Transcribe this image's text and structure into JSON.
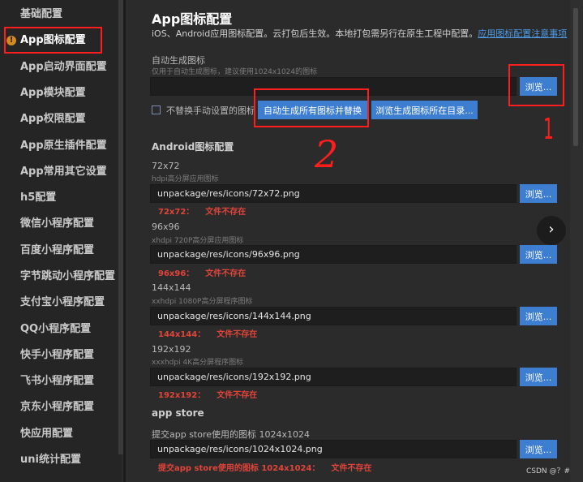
{
  "sidebar": {
    "items": [
      {
        "label": "基础配置"
      },
      {
        "label": "App图标配置"
      },
      {
        "label": "App启动界面配置"
      },
      {
        "label": "App模块配置"
      },
      {
        "label": "App权限配置"
      },
      {
        "label": "App原生插件配置"
      },
      {
        "label": "App常用其它设置"
      },
      {
        "label": "h5配置"
      },
      {
        "label": "微信小程序配置"
      },
      {
        "label": "百度小程序配置"
      },
      {
        "label": "字节跳动小程序配置"
      },
      {
        "label": "支付宝小程序配置"
      },
      {
        "label": "QQ小程序配置"
      },
      {
        "label": "快手小程序配置"
      },
      {
        "label": "飞书小程序配置"
      },
      {
        "label": "京东小程序配置"
      },
      {
        "label": "快应用配置"
      },
      {
        "label": "uni统计配置"
      }
    ],
    "warning_icon": "!"
  },
  "main": {
    "title": "App图标配置",
    "subtitle": "iOS、Android应用图标配置。云打包后生效。本地打包需另行在原生工程中配置。",
    "subtitle_link": "应用图标配置注意事项",
    "auto": {
      "label": "自动生成图标",
      "hint": "仅用于自动生成图标，建议使用1024x1024的图标",
      "value": "",
      "browse": "浏览...",
      "checkbox_label": "不替换手动设置的图标",
      "generate_button": "自动生成所有图标并替换",
      "browse_dir_button": "浏览生成图标所在目录..."
    },
    "android_section": "Android图标配置",
    "icons": [
      {
        "size": "72x72",
        "hint": "hdpi高分屏应用图标",
        "path": "unpackage/res/icons/72x72.png",
        "browse": "浏览...",
        "error_key": "72x72：",
        "error_msg": "文件不存在"
      },
      {
        "size": "96x96",
        "hint": "xhdpi 720P高分屏应用图标",
        "path": "unpackage/res/icons/96x96.png",
        "browse": "浏览...",
        "error_key": "96x96：",
        "error_msg": "文件不存在"
      },
      {
        "size": "144x144",
        "hint": "xxhdpi 1080P高分屏程序图标",
        "path": "unpackage/res/icons/144x144.png",
        "browse": "浏览...",
        "error_key": "144x144：",
        "error_msg": "文件不存在"
      },
      {
        "size": "192x192",
        "hint": "xxxhdpi 4K高分屏程序图标",
        "path": "unpackage/res/icons/192x192.png",
        "browse": "浏览...",
        "error_key": "192x192：",
        "error_msg": "文件不存在"
      }
    ],
    "appstore": {
      "section": "app store",
      "label": "提交app store使用的图标 1024x1024",
      "path": "unpackage/res/icons/1024x1024.png",
      "browse": "浏览...",
      "error_key": "提交app store使用的图标 1024x1024：",
      "error_msg": "文件不存在"
    }
  },
  "annotations": {
    "mark1": "1",
    "mark2": "2"
  },
  "float_nav": "›",
  "watermark": "CSDN @？#",
  "colors": {
    "accent": "#3d7ed0",
    "error": "#e0443a",
    "annotation_red": "#ff1d1d",
    "link": "#4e9be6"
  }
}
